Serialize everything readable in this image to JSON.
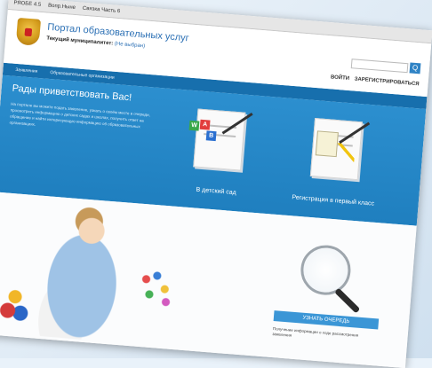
{
  "browser": {
    "tabs": [
      "РЯОБЕ 4.5",
      "Вопр.Ныне",
      "Связка Часть 6"
    ]
  },
  "header": {
    "title": "Портал образовательных услуг",
    "municipality_label": "Текущий муниципалитет:",
    "municipality_link": "(Не выбран)",
    "search_button": "Q",
    "login": "ВОЙТИ",
    "register": "ЗАРЕГИСТРИРОВАТЬСЯ"
  },
  "nav": {
    "items": [
      "Заявления",
      "Образовательные организации"
    ]
  },
  "hero": {
    "welcome": "Рады приветствовать Вас!",
    "intro": "На портале вы можете подать заявление, узнать о своём месте в очереди, просмотреть информацию о детских садах и школах, получить ответ на обращение и найти интересующую информацию об образовательных организациях.",
    "cards": [
      {
        "label": "В детский сад",
        "icon": "kindergarten-blocks-icon",
        "blocks": [
          "W",
          "A",
          "B"
        ]
      },
      {
        "label": "Регистрация в первый класс",
        "icon": "school-calculator-icon"
      }
    ]
  },
  "lower": {
    "queue_button": "УЗНАТЬ ОЧЕРЕДЬ",
    "queue_note": "Получение информации о ходе рассмотрения заявления"
  },
  "colors": {
    "hero_blue": "#2c8fcf",
    "nav_blue": "#176fad",
    "link_blue": "#2a6fb4",
    "button_blue": "#3b96d6"
  }
}
